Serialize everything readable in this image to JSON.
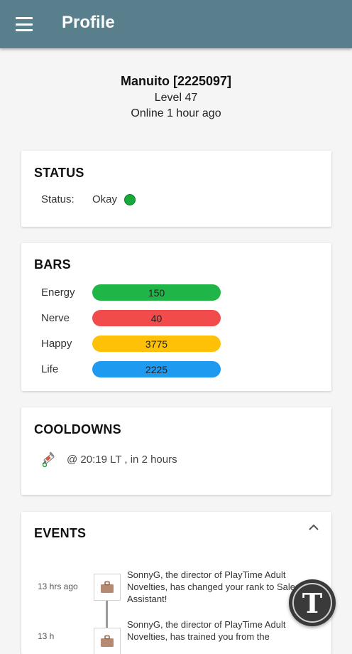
{
  "appbar": {
    "title": "Profile"
  },
  "profile": {
    "name": "Manuito [2225097]",
    "level": "Level 47",
    "online": "Online 1 hour ago"
  },
  "status": {
    "title": "STATUS",
    "label": "Status:",
    "value": "Okay",
    "dot_color": "#19a83a"
  },
  "bars": {
    "title": "BARS",
    "items": [
      {
        "label": "Energy",
        "value": "150",
        "color": "#1fb547"
      },
      {
        "label": "Nerve",
        "value": "40",
        "color": "#f24b4b"
      },
      {
        "label": "Happy",
        "value": "3775",
        "color": "#ffc107"
      },
      {
        "label": "Life",
        "value": "2225",
        "color": "#1e9bf0"
      }
    ]
  },
  "cooldowns": {
    "title": "COOLDOWNS",
    "items": [
      {
        "icon": "booster-syringe-icon",
        "text": "@ 20:19 LT , in 2 hours"
      }
    ]
  },
  "events": {
    "title": "EVENTS",
    "items": [
      {
        "time": "13 hrs ago",
        "icon": "briefcase-icon",
        "text": "SonnyG, the director of PlayTime Adult Novelties, has changed your rank to Sales Assistant!"
      },
      {
        "time": "13 h",
        "icon": "briefcase-icon",
        "text": "SonnyG, the director of PlayTime Adult Novelties, has trained you from the"
      }
    ]
  },
  "fab": {
    "letter": "T"
  }
}
